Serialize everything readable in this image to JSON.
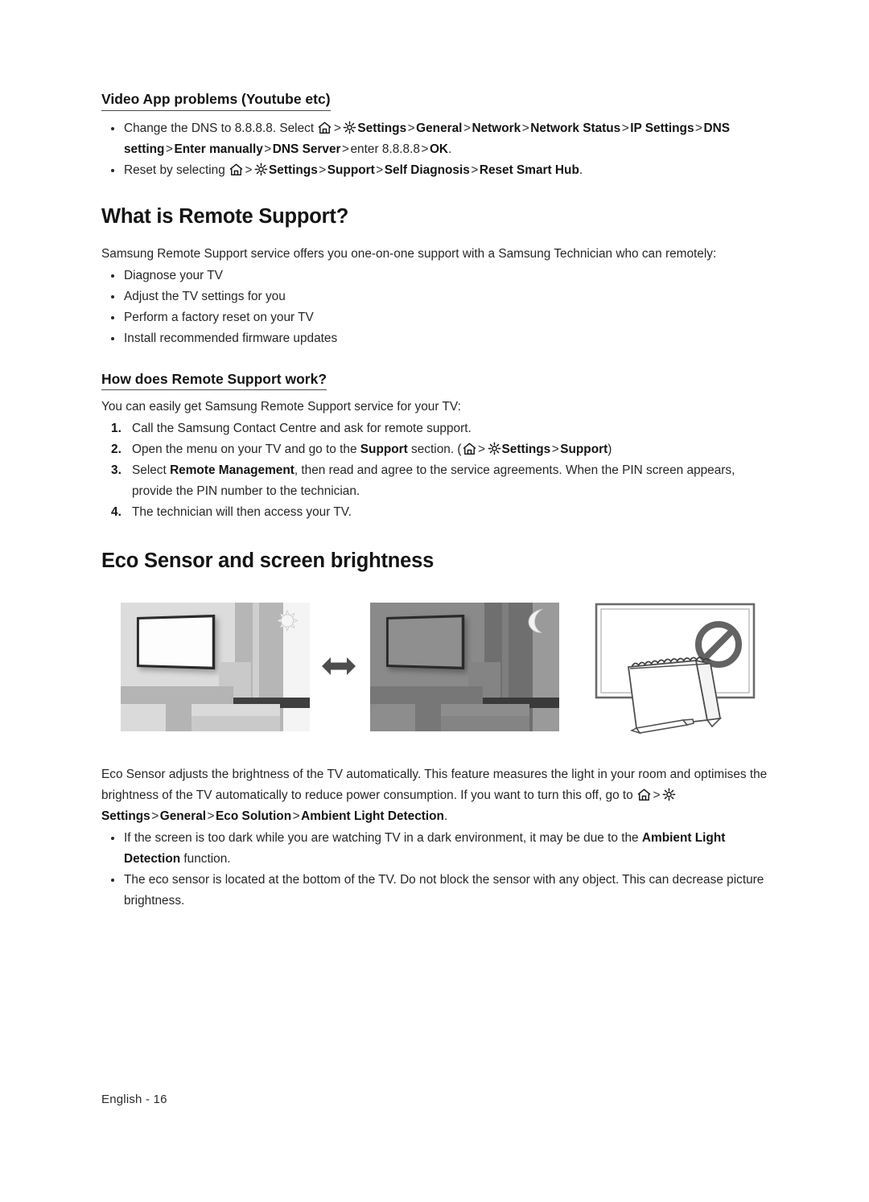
{
  "document": {
    "footer": "English - 16"
  },
  "sections": {
    "video_app": {
      "heading": "Video App problems (Youtube etc)",
      "bullets": [
        {
          "parts": [
            {
              "t": "Change the DNS to 8.8.8.8. Select ",
              "b": false
            },
            {
              "icon": "home-icon"
            },
            {
              "t": ">",
              "sep": true
            },
            {
              "icon": "gear-icon"
            },
            {
              "t": "Settings",
              "b": true
            },
            {
              "t": ">",
              "sep": true
            },
            {
              "t": "General",
              "b": true
            },
            {
              "t": ">",
              "sep": true
            },
            {
              "t": "Network",
              "b": true
            },
            {
              "t": ">",
              "sep": true
            },
            {
              "t": "Network Status",
              "b": true
            },
            {
              "t": ">",
              "sep": true
            },
            {
              "t": "IP Settings",
              "b": true
            },
            {
              "t": ">",
              "sep": true
            },
            {
              "t": "DNS setting",
              "b": true
            },
            {
              "t": ">",
              "sep": true
            },
            {
              "t": "Enter manually",
              "b": true
            },
            {
              "t": ">",
              "sep": true
            },
            {
              "t": "DNS Server",
              "b": true
            },
            {
              "t": ">",
              "sep": true
            },
            {
              "t": "enter 8.8.8.8",
              "b": false
            },
            {
              "t": ">",
              "sep": true
            },
            {
              "t": "OK",
              "b": true
            },
            {
              "t": ".",
              "b": false
            }
          ]
        },
        {
          "parts": [
            {
              "t": "Reset by selecting ",
              "b": false
            },
            {
              "icon": "home-icon"
            },
            {
              "t": ">",
              "sep": true
            },
            {
              "icon": "gear-icon"
            },
            {
              "t": "Settings",
              "b": true
            },
            {
              "t": ">",
              "sep": true
            },
            {
              "t": "Support",
              "b": true
            },
            {
              "t": ">",
              "sep": true
            },
            {
              "t": "Self Diagnosis",
              "b": true
            },
            {
              "t": ">",
              "sep": true
            },
            {
              "t": "Reset Smart Hub",
              "b": true
            },
            {
              "t": ".",
              "b": false
            }
          ]
        }
      ]
    },
    "remote_support": {
      "heading": "What is Remote Support?",
      "intro": "Samsung Remote Support service offers you one-on-one support with a Samsung Technician who can remotely:",
      "bullets": [
        "Diagnose your TV",
        "Adjust the TV settings for you",
        "Perform a factory reset on your TV",
        "Install recommended firmware updates"
      ],
      "subheading": "How does Remote Support work?",
      "sub_intro": "You can easily get Samsung Remote Support service for your TV:",
      "steps": [
        {
          "parts": [
            {
              "t": "Call the Samsung Contact Centre and ask for remote support.",
              "b": false
            }
          ]
        },
        {
          "parts": [
            {
              "t": "Open the menu on your TV and go to the ",
              "b": false
            },
            {
              "t": "Support",
              "b": true
            },
            {
              "t": " section. (",
              "b": false
            },
            {
              "icon": "home-icon"
            },
            {
              "t": ">",
              "sep": true
            },
            {
              "icon": "gear-icon"
            },
            {
              "t": "Settings",
              "b": true
            },
            {
              "t": ">",
              "sep": true
            },
            {
              "t": "Support",
              "b": true
            },
            {
              "t": ")",
              "b": false
            }
          ]
        },
        {
          "parts": [
            {
              "t": "Select ",
              "b": false
            },
            {
              "t": "Remote Management",
              "b": true
            },
            {
              "t": ", then read and agree to the service agreements. When the PIN screen appears, provide the PIN number to the technician.",
              "b": false
            }
          ]
        },
        {
          "parts": [
            {
              "t": "The technician will then access your TV.",
              "b": false
            }
          ]
        }
      ]
    },
    "eco_sensor": {
      "heading": "Eco Sensor and screen brightness",
      "figures": {
        "bright_room": {
          "label": "bright-room-illustration",
          "badge": "sun-icon"
        },
        "arrow": {
          "label": "double-arrow-icon"
        },
        "dark_room": {
          "label": "dark-room-illustration",
          "badge": "moon-icon"
        },
        "blocked_sensor": {
          "label": "blocked-sensor-illustration",
          "badge": "prohibition-icon"
        }
      },
      "body_parts": [
        {
          "t": "Eco Sensor adjusts the brightness of the TV automatically. This feature measures the light in your room and optimises the brightness of the TV automatically to reduce power consumption. If you want to turn this off, go to ",
          "b": false
        },
        {
          "icon": "home-icon"
        },
        {
          "t": ">",
          "sep": true
        },
        {
          "icon": "gear-icon"
        },
        {
          "t": "Settings",
          "b": true
        },
        {
          "t": ">",
          "sep": true
        },
        {
          "t": "General",
          "b": true
        },
        {
          "t": ">",
          "sep": true
        },
        {
          "t": "Eco Solution",
          "b": true
        },
        {
          "t": ">",
          "sep": true
        },
        {
          "t": "Ambient Light Detection",
          "b": true
        },
        {
          "t": ".",
          "b": false
        }
      ],
      "bullets": [
        {
          "parts": [
            {
              "t": "If the screen is too dark while you are watching TV in a dark environment, it may be due to the ",
              "b": false
            },
            {
              "t": "Ambient Light Detection",
              "b": true
            },
            {
              "t": " function.",
              "b": false
            }
          ]
        },
        {
          "parts": [
            {
              "t": "The eco sensor is located at the bottom of the TV. Do not block the sensor with any object. This can decrease picture brightness.",
              "b": false
            }
          ]
        }
      ]
    }
  }
}
